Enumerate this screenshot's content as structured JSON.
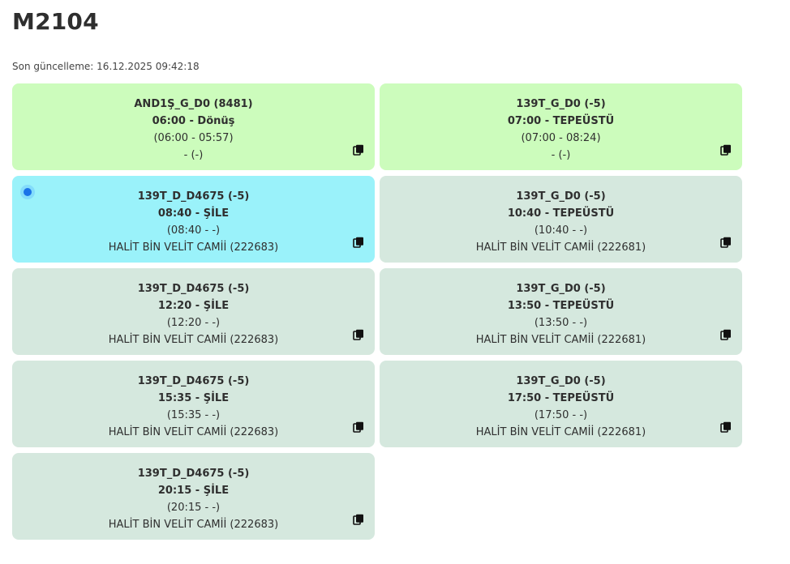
{
  "title": "M2104",
  "last_updated": "Son güncelleme: 16.12.2025 09:42:18",
  "cards": [
    {
      "line1": "AND1Ş_G_D0 (8481)",
      "line2": "06:00 - Dönüş",
      "line3": "(06:00 - 05:57)",
      "line4": "- (-)",
      "color": "#ccfcbc",
      "icon": "copy-icon"
    },
    {
      "line1": "139T_G_D0 (-5)",
      "line2": "07:00 - TEPEÜSTÜ",
      "line3": "(07:00 - 08:24)",
      "line4": "- (-)",
      "color": "#ccfcbc",
      "icon": "copy-icon"
    },
    {
      "line1": "139T_D_D4675 (-5)",
      "line2": "08:40 - ŞİLE",
      "line3": "(08:40 - -)",
      "line4": "HALİT BİN VELİT CAMİİ (222683)",
      "color": "#9af2fa",
      "icon": "copy-icon"
    },
    {
      "line1": "139T_G_D0 (-5)",
      "line2": "10:40 - TEPEÜSTÜ",
      "line3": "(10:40 - -)",
      "line4": "HALİT BİN VELİT CAMİİ (222681)",
      "color": "#d5e8de",
      "icon": "copy-icon"
    },
    {
      "line1": "139T_D_D4675 (-5)",
      "line2": "12:20 - ŞİLE",
      "line3": "(12:20 - -)",
      "line4": "HALİT BİN VELİT CAMİİ (222683)",
      "color": "#d5e8de",
      "icon": "copy-icon"
    },
    {
      "line1": "139T_G_D0 (-5)",
      "line2": "13:50 - TEPEÜSTÜ",
      "line3": "(13:50 - -)",
      "line4": "HALİT BİN VELİT CAMİİ (222681)",
      "color": "#d5e8de",
      "icon": "copy-icon"
    },
    {
      "line1": "139T_D_D4675 (-5)",
      "line2": "15:35 - ŞİLE",
      "line3": "(15:35 - -)",
      "line4": "HALİT BİN VELİT CAMİİ (222683)",
      "color": "#d5e8de",
      "icon": "copy-icon"
    },
    {
      "line1": "139T_G_D0 (-5)",
      "line2": "17:50 - TEPEÜSTÜ",
      "line3": "(17:50 - -)",
      "line4": "HALİT BİN VELİT CAMİİ (222681)",
      "color": "#d5e8de",
      "icon": "copy-icon"
    },
    {
      "line1": "139T_D_D4675 (-5)",
      "line2": "20:15 - ŞİLE",
      "line3": "(20:15 - -)",
      "line4": "HALİT BİN VELİT CAMİİ (222683)",
      "color": "#d5e8de",
      "icon": "copy-icon"
    }
  ]
}
